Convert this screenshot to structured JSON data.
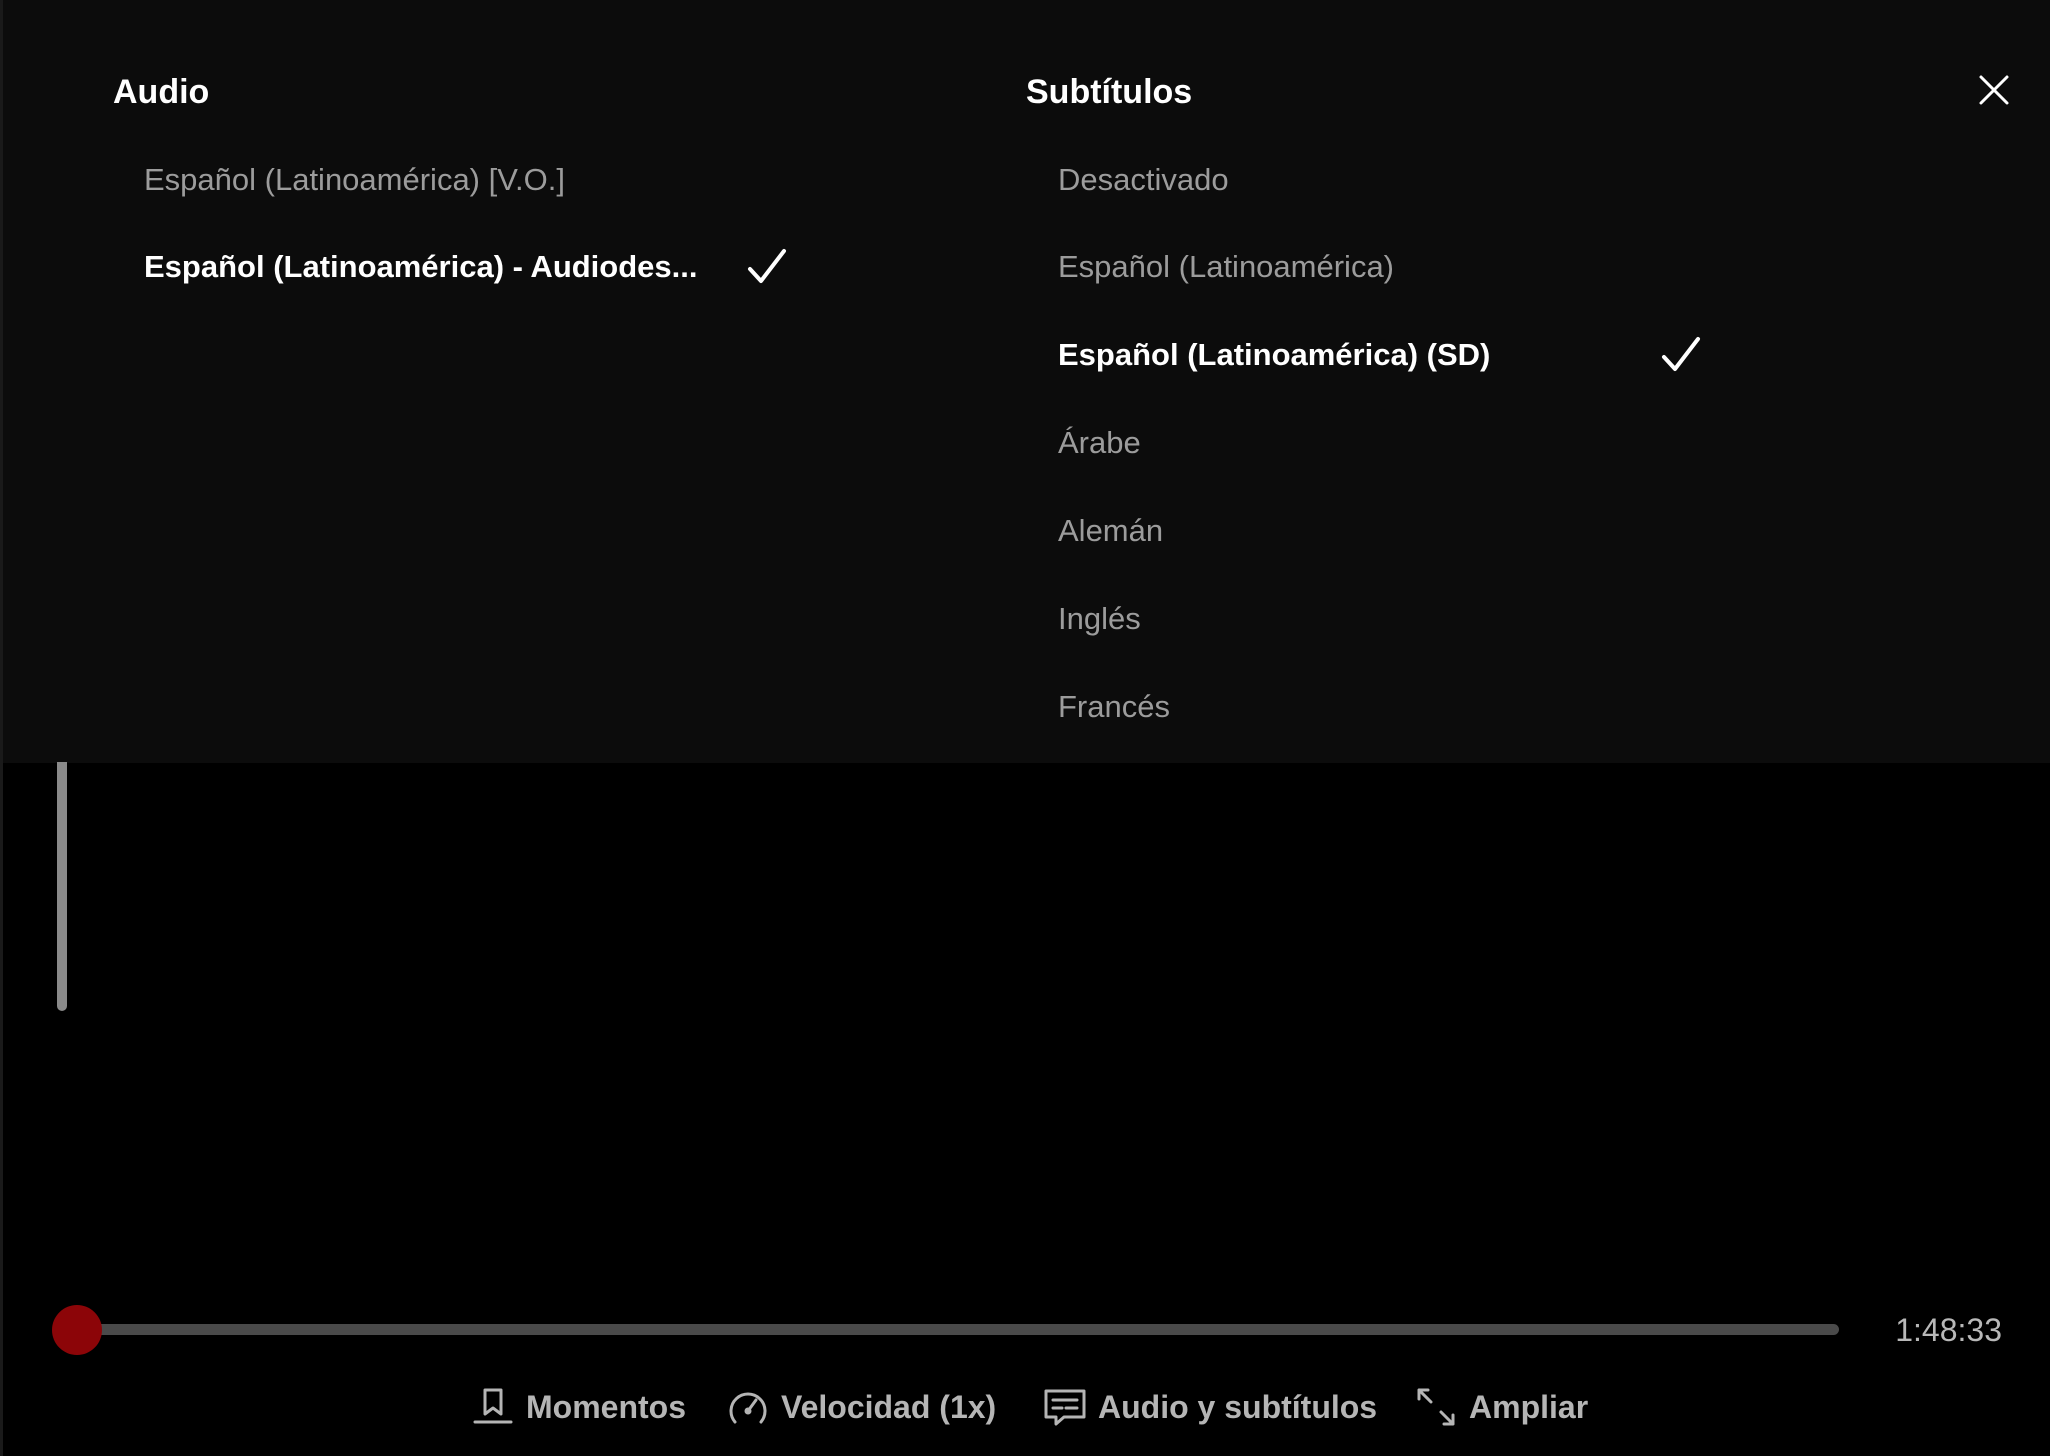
{
  "audio": {
    "title": "Audio",
    "options": [
      {
        "label": "Español (Latinoamérica) [V.O.]",
        "selected": false
      },
      {
        "label": "Español (Latinoamérica) - Audiodes...",
        "selected": true
      }
    ]
  },
  "subtitles": {
    "title": "Subtítulos",
    "options": [
      {
        "label": "Desactivado",
        "selected": false
      },
      {
        "label": "Español (Latinoamérica)",
        "selected": false
      },
      {
        "label": "Español (Latinoamérica)  (SD)",
        "selected": true
      },
      {
        "label": "Árabe",
        "selected": false
      },
      {
        "label": "Alemán",
        "selected": false
      },
      {
        "label": "Inglés",
        "selected": false
      },
      {
        "label": "Francés",
        "selected": false
      }
    ]
  },
  "player": {
    "time_remaining": "1:48:33",
    "progress_fraction": 0.0,
    "accent_color": "#b00710"
  },
  "controls": {
    "moments_label": "Momentos",
    "speed_label": "Velocidad (1x)",
    "audio_subtitles_label": "Audio y subtítulos",
    "expand_label": "Ampliar"
  },
  "icons": {
    "close": "close-icon",
    "check": "check-icon",
    "moments": "bookmark-icon",
    "speed": "speedometer-icon",
    "audio_subtitles": "subtitles-icon",
    "expand": "expand-icon"
  }
}
